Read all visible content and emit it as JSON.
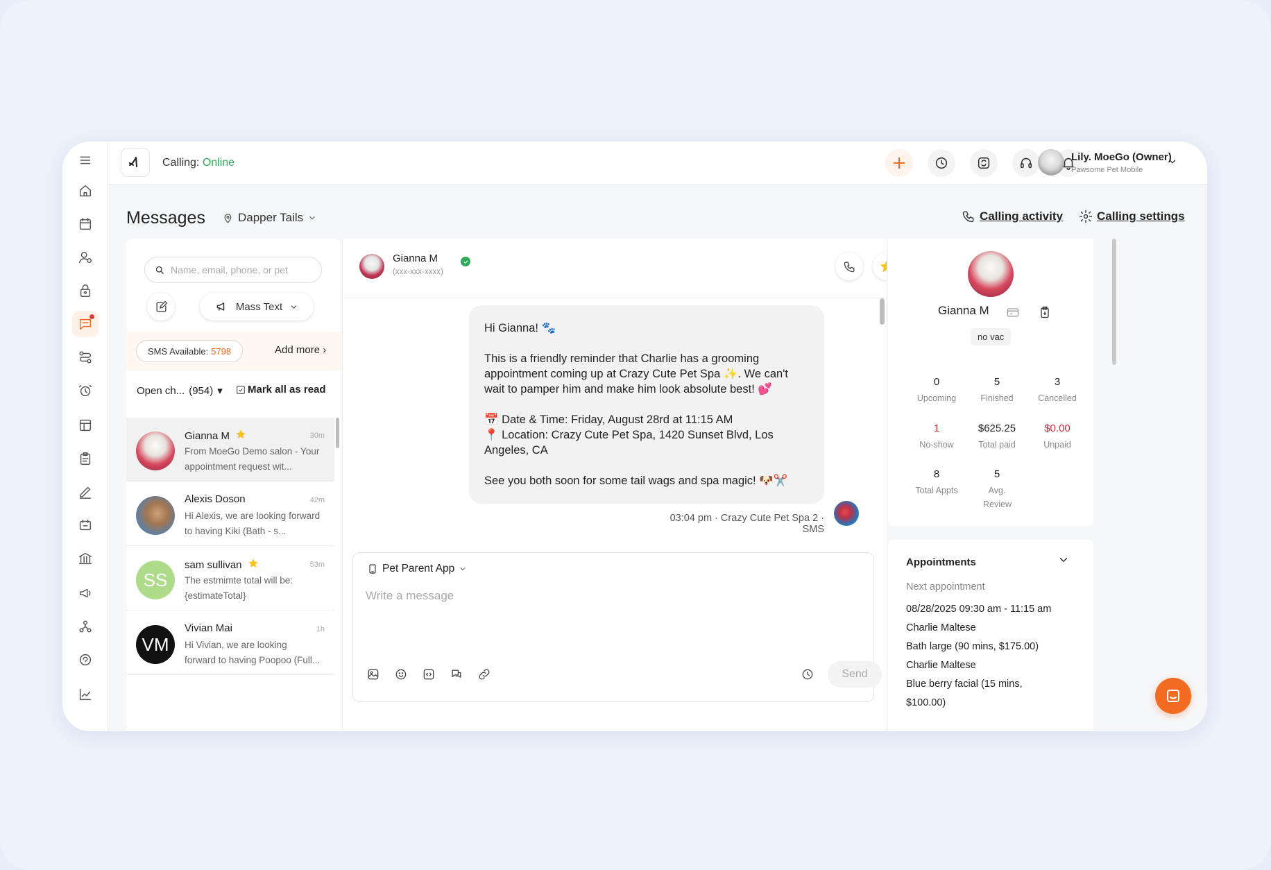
{
  "colors": {
    "accent": "#f26b21",
    "online": "#2fa85a",
    "star": "#f8c21c",
    "unpaid": "#c62c3b"
  },
  "topbar": {
    "calling_label": "Calling:",
    "calling_status": "Online",
    "user_name": "Lily. MoeGo (Owner)",
    "user_sub": "Pawsome Pet Mobile"
  },
  "header": {
    "title": "Messages",
    "location": "Dapper Tails",
    "calling_activity": "Calling activity",
    "calling_settings": "Calling settings"
  },
  "list": {
    "search_placeholder": "Name, email, phone, or pet",
    "mass_text": "Mass Text",
    "sms_label": "SMS Available:",
    "sms_count": "5798",
    "add_more": "Add more",
    "add_more_chevron": "›",
    "filter_label": "Open ch...",
    "filter_count": "(954)",
    "filter_arrow": "▾",
    "mark_all": "Mark all as read",
    "conversations": [
      {
        "name": "Gianna M",
        "time": "30m",
        "preview": "From MoeGo Demo salon - Your appointment request wit...",
        "starred": true,
        "initials": ""
      },
      {
        "name": "Alexis Doson",
        "time": "42m",
        "preview": "Hi Alexis, we are looking forward to having Kiki (Bath - s...",
        "starred": false,
        "initials": ""
      },
      {
        "name": "sam sullivan",
        "time": "53m",
        "preview": "The estmimte total will be:{estimateTotal}",
        "starred": true,
        "initials": "SS"
      },
      {
        "name": "Vivian Mai",
        "time": "1h",
        "preview": "Hi Vivian, we are looking forward to having Poopoo (Full...",
        "starred": false,
        "initials": "VM"
      }
    ]
  },
  "chat": {
    "name": "Gianna M",
    "phone": "(xxx-xxx-xxxx)",
    "message": {
      "greeting": "Hi Gianna! 🐾",
      "body": "This is a friendly reminder that Charlie has a grooming appointment coming up at Crazy Cute Pet Spa ✨. We can't wait to pamper him and make him look absolute best! 💕",
      "datetime": "📅 Date & Time: Friday, August 28rd at 11:15 AM",
      "location": "📍 Location: Crazy Cute Pet Spa, 1420 Sunset Blvd, Los Angeles, CA",
      "closing": "See you both soon for some tail wags and spa magic! 🐶✂️"
    },
    "meta": "03:04 pm · Crazy Cute Pet Spa 2 · SMS",
    "composer": {
      "channel": "Pet Parent App",
      "placeholder": "Write a message",
      "send": "Send"
    }
  },
  "profile": {
    "name": "Gianna M",
    "tag": "no vac",
    "stats": [
      {
        "value": "0",
        "label": "Upcoming"
      },
      {
        "value": "5",
        "label": "Finished"
      },
      {
        "value": "3",
        "label": "Cancelled"
      },
      {
        "value": "1",
        "label": "No-show"
      },
      {
        "value": "$625.25",
        "label": "Total paid"
      },
      {
        "value": "$0.00",
        "label": "Unpaid"
      },
      {
        "value": "8",
        "label": "Total Appts"
      },
      {
        "value": "5",
        "label": "Avg. Review"
      }
    ],
    "appointments": {
      "title": "Appointments",
      "next_label": "Next appointment",
      "lines": [
        "08/28/2025 09:30 am - 11:15 am",
        "Charlie Maltese",
        "Bath large (90 mins, $175.00)",
        "Charlie Maltese",
        "Blue berry facial (15 mins,",
        "$100.00)"
      ]
    }
  },
  "icons": {
    "sidebar": [
      "home-icon",
      "calendar-icon",
      "clients-icon",
      "lock-icon",
      "messages-icon",
      "workflow-icon",
      "alarm-icon",
      "table-icon",
      "clipboard-icon",
      "pen-icon",
      "ticket-icon",
      "bank-icon",
      "megaphone-icon",
      "network-icon",
      "support-icon",
      "chart-icon"
    ],
    "top": [
      "plus-icon",
      "clock-icon",
      "refresh-icon",
      "headset-icon",
      "bell-icon"
    ]
  }
}
